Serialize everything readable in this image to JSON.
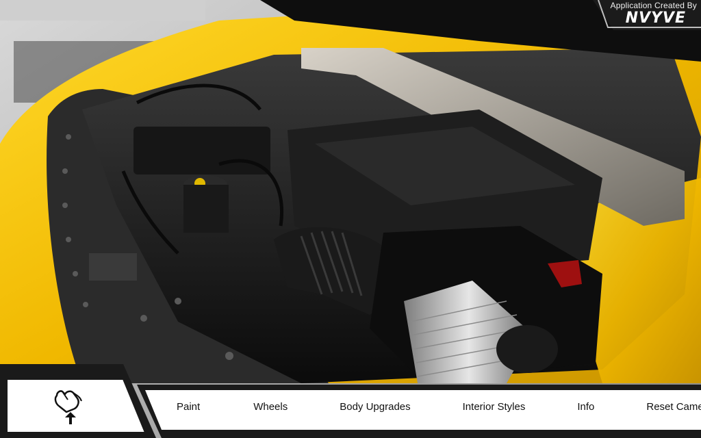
{
  "branding": {
    "caption": "Application Created By",
    "logo": "NVYVE"
  },
  "scene": {
    "subject": "engine-bay-3d-view",
    "colors": {
      "body_yellow": "#f2c200",
      "engine_black": "#161616",
      "radiator_panel": "#2a2a2a",
      "filter_gray": "#b9b9b9",
      "cap_red": "#9e1010"
    }
  },
  "toolbar": {
    "hand_icon": "hand-tap-icon",
    "items": [
      {
        "label": "Paint"
      },
      {
        "label": "Wheels"
      },
      {
        "label": "Body Upgrades"
      },
      {
        "label": "Interior Styles"
      },
      {
        "label": "Info"
      },
      {
        "label": "Reset Camera"
      }
    ]
  }
}
